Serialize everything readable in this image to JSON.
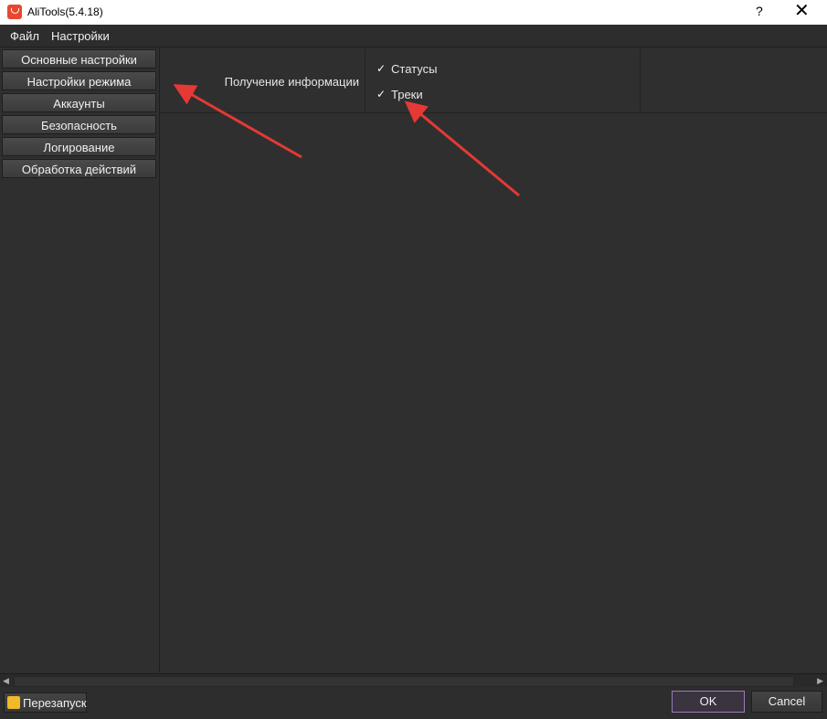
{
  "window": {
    "title": "AliTools(5.4.18)",
    "help_label": "?",
    "close_label": "✕",
    "app_icon": "aliexpress-bag-icon"
  },
  "menu": {
    "items": [
      "Файл",
      "Настройки"
    ]
  },
  "sidebar": {
    "items": [
      {
        "label": "Основные настройки"
      },
      {
        "label": "Настройки режима"
      },
      {
        "label": "Аккаунты"
      },
      {
        "label": "Безопасность"
      },
      {
        "label": "Логирование"
      },
      {
        "label": "Обработка действий"
      }
    ]
  },
  "settings": {
    "row_label": "Получение информации",
    "options": [
      {
        "label": "Статусы",
        "checked": true
      },
      {
        "label": "Треки",
        "checked": true
      }
    ],
    "check_glyph": "✓"
  },
  "footer": {
    "restart_label": "Перезапуск",
    "restart_icon": "restart-icon",
    "ok_label": "OK",
    "cancel_label": "Cancel"
  },
  "colors": {
    "background": "#2d2d2d",
    "annotation_arrow": "#e53935",
    "ok_border": "#9a7ab8"
  }
}
